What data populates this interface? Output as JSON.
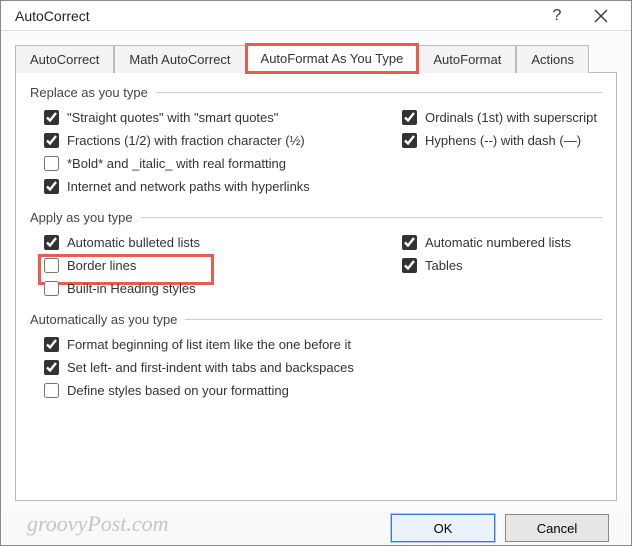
{
  "title": "AutoCorrect",
  "tabs": {
    "t0": "AutoCorrect",
    "t1": "Math AutoCorrect",
    "t2": "AutoFormat As You Type",
    "t3": "AutoFormat",
    "t4": "Actions"
  },
  "sections": {
    "replace": {
      "label": "Replace as you type",
      "left": {
        "smart_quotes": {
          "label": "\"Straight quotes\" with \"smart quotes\"",
          "checked": true
        },
        "fractions": {
          "label": "Fractions (1/2) with fraction character (½)",
          "checked": true
        },
        "bold_italic": {
          "label": "*Bold* and _italic_ with real formatting",
          "checked": false
        },
        "hyperlinks": {
          "label": "Internet and network paths with hyperlinks",
          "checked": true
        }
      },
      "right": {
        "ordinals": {
          "label": "Ordinals (1st) with superscript",
          "checked": true
        },
        "hyphens": {
          "label": "Hyphens (--) with dash (—)",
          "checked": true
        }
      }
    },
    "apply": {
      "label": "Apply as you type",
      "left": {
        "bulleted": {
          "label": "Automatic bulleted lists",
          "checked": true
        },
        "border": {
          "label": "Border lines",
          "checked": false
        },
        "heading": {
          "label": "Built-in Heading styles",
          "checked": false
        }
      },
      "right": {
        "numbered": {
          "label": "Automatic numbered lists",
          "checked": true
        },
        "tables": {
          "label": "Tables",
          "checked": true
        }
      }
    },
    "auto": {
      "label": "Automatically as you type",
      "items": {
        "format_list": {
          "label": "Format beginning of list item like the one before it",
          "checked": true
        },
        "tabs_backspace": {
          "label": "Set left- and first-indent with tabs and backspaces",
          "checked": true
        },
        "define_styles": {
          "label": "Define styles based on your formatting",
          "checked": false
        }
      }
    }
  },
  "buttons": {
    "ok": "OK",
    "cancel": "Cancel"
  },
  "watermark": "groovyPost.com"
}
